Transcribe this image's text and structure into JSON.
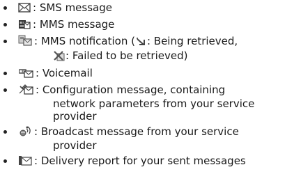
{
  "items": [
    {
      "icon": "sms-envelope-icon",
      "line1": ": SMS message"
    },
    {
      "icon": "mms-icon",
      "line1": ": MMS message"
    },
    {
      "icon": "mms-notification-icon",
      "line1_a": ": MMS notification (",
      "being_retrieved_icon": "retrieving-arrow-icon",
      "line1_b": ": Being retrieved,",
      "failed_icon": "failed-retrieval-icon",
      "line2": ": Failed to be retrieved)"
    },
    {
      "icon": "voicemail-icon",
      "line1": ": Voicemail"
    },
    {
      "icon": "configuration-icon",
      "line1": ": Configuration message, containing",
      "line2": "network parameters from your service",
      "line3": "provider"
    },
    {
      "icon": "broadcast-icon",
      "line1": ": Broadcast message from your service",
      "line2": "provider"
    },
    {
      "icon": "delivery-report-icon",
      "line1": ": Delivery report for your sent messages"
    }
  ]
}
